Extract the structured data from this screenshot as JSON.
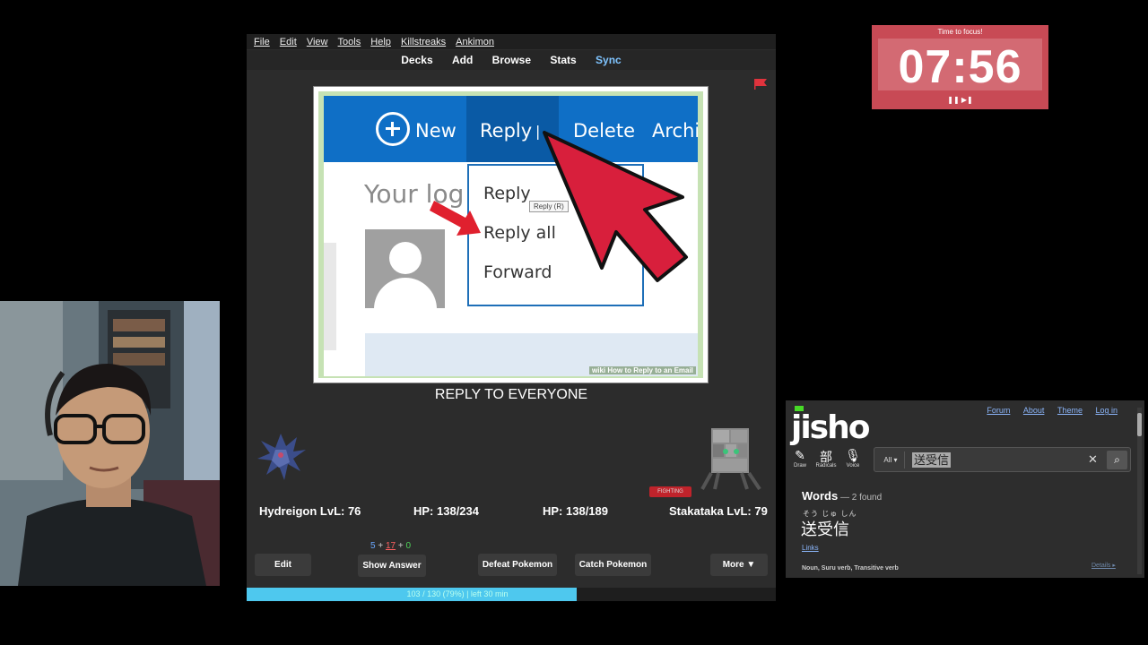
{
  "anki": {
    "menu": [
      "File",
      "Edit",
      "View",
      "Tools",
      "Help",
      "Killstreaks",
      "Ankimon"
    ],
    "toolbar": [
      "Decks",
      "Add",
      "Browse",
      "Stats",
      "Sync"
    ],
    "card_image": {
      "ribbon": {
        "new": "New",
        "reply": "Reply",
        "delete": "Delete",
        "archive": "Archiv"
      },
      "heading": "Your log",
      "dropdown": [
        "Reply",
        "Reply all",
        "Forward"
      ],
      "tooltip": "Reply (R)",
      "watermark": "wiki How to Reply to an Email"
    },
    "answer": "REPLY TO EVERYONE",
    "battle": {
      "player_name": "Hydreigon LvL: 76",
      "player_hp": "HP: 138/234",
      "enemy_hp": "HP: 138/189",
      "enemy_name": "Stakataka LvL: 79",
      "enemy_type": "FIGHTING"
    },
    "counts": {
      "new": "5",
      "plus1": " + ",
      "learn": "17",
      "plus2": " + ",
      "review": "0"
    },
    "buttons": {
      "edit": "Edit",
      "show_answer": "Show Answer",
      "defeat": "Defeat Pokemon",
      "catch": "Catch Pokemon",
      "more": "More ▼"
    },
    "progress": {
      "text": "103 / 130 (79%) | left 30 min",
      "fraction": 0.79
    }
  },
  "timer": {
    "label": "Time to focus!",
    "value": "07:56",
    "controls": "❚❚ ▶❚"
  },
  "jisho": {
    "logo": "jisho",
    "nav": [
      "Forum",
      "About",
      "Theme",
      "Log in"
    ],
    "tools": [
      {
        "glyph": "✎",
        "label": "Draw"
      },
      {
        "glyph": "部",
        "label": "Radicals"
      },
      {
        "glyph": "🎙",
        "label": "Voice"
      }
    ],
    "search": {
      "filter": "All ▾",
      "value": "送受信"
    },
    "words_title": "Words",
    "words_count": " — 2 found",
    "result": {
      "furigana": "そう じゅ しん",
      "word": "送受信",
      "links": "Links",
      "pos": "Noun, Suru verb, Transitive verb",
      "details": "Details ▸"
    }
  },
  "colors": {
    "progress": "#4ec8ee",
    "timer": "#c84a55",
    "jisho_green": "#47db27"
  }
}
